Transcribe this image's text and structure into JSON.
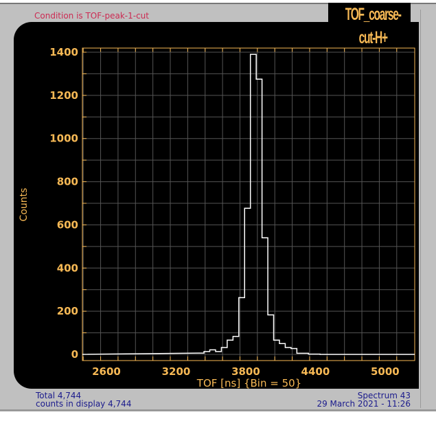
{
  "header": {
    "condition": "Condition is TOF-peak-1-cut",
    "title": "TOF_coarse-cut-H+"
  },
  "footer": {
    "total": "Total 4,744",
    "counts_in_display": "counts in display 4,744",
    "spectrum": "Spectrum 43",
    "datetime": "29 March 2021 - 11:26"
  },
  "colors": {
    "axis": "#f7b955",
    "grid": "#555555",
    "line": "#ffffff",
    "background": "#000000"
  },
  "chart_data": {
    "type": "histogram",
    "xlabel": "TOF [ns] {Bin = 50}",
    "ylabel": "Counts",
    "xlim": [
      2393,
      5255
    ],
    "ylim": [
      0,
      1420
    ],
    "xticks": [
      2600,
      3200,
      3800,
      4400,
      5000
    ],
    "yticks": [
      0,
      200,
      400,
      600,
      800,
      1000,
      1200,
      1400
    ],
    "bin_width": 50,
    "bin_start": 3390,
    "values": [
      6,
      13,
      21,
      13,
      32,
      66,
      83,
      263,
      677,
      1390,
      1275,
      540,
      183,
      66,
      50,
      32,
      27,
      5,
      5,
      1,
      1
    ],
    "grid": true
  }
}
